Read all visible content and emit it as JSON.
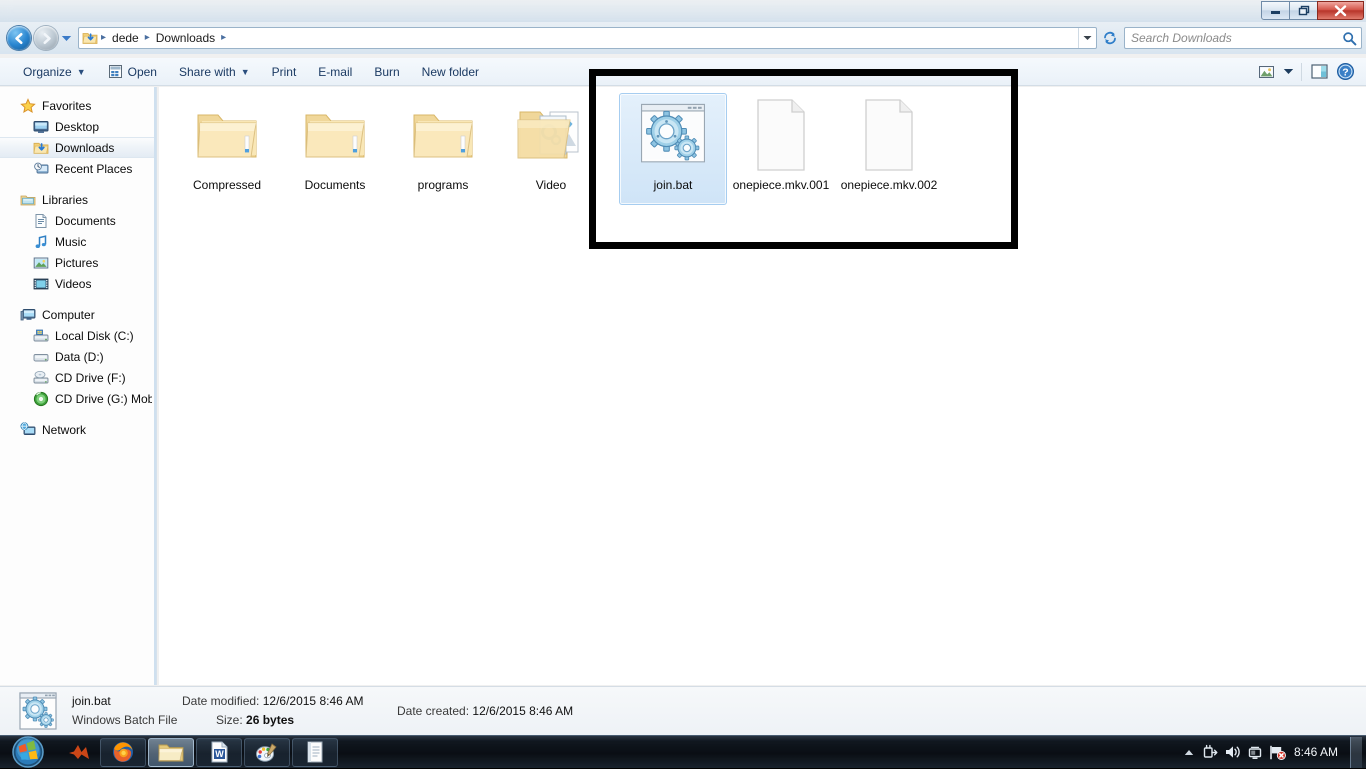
{
  "window": {
    "controls": {
      "minimize_label": "Minimize",
      "restore_label": "Restore Down",
      "close_label": "Close"
    }
  },
  "navigation": {
    "back_label": "Back",
    "forward_label": "Forward",
    "history_label": "Recent pages",
    "refresh_label": "Refresh",
    "address_icon": "downloads-folder-icon",
    "breadcrumbs": [
      "dede",
      "Downloads"
    ],
    "separator": "▸"
  },
  "search": {
    "placeholder": "Search Downloads",
    "value": "",
    "icon": "search-icon"
  },
  "command_bar": {
    "items": [
      {
        "label": "Organize",
        "icon": "",
        "caret": true
      },
      {
        "label": "Open",
        "icon": "open-file-icon",
        "caret": false
      },
      {
        "label": "Share with",
        "icon": "",
        "caret": true
      },
      {
        "label": "Print",
        "icon": "",
        "caret": false
      },
      {
        "label": "E-mail",
        "icon": "",
        "caret": false
      },
      {
        "label": "Burn",
        "icon": "",
        "caret": false
      },
      {
        "label": "New folder",
        "icon": "",
        "caret": false
      }
    ],
    "right_buttons": [
      {
        "name": "change-view-button",
        "icon": "view-icon"
      },
      {
        "name": "change-view-dropdown",
        "icon": "chevron-down-icon"
      },
      {
        "name": "preview-pane-button",
        "icon": "preview-pane-icon"
      },
      {
        "name": "help-button",
        "icon": "help-icon"
      }
    ]
  },
  "sidebar": {
    "groups": [
      {
        "root": {
          "label": "Favorites",
          "icon": "star-icon"
        },
        "items": [
          {
            "label": "Desktop",
            "icon": "desktop-icon",
            "selected": false
          },
          {
            "label": "Downloads",
            "icon": "downloads-folder-icon",
            "selected": true
          },
          {
            "label": "Recent Places",
            "icon": "recent-places-icon",
            "selected": false
          }
        ]
      },
      {
        "root": {
          "label": "Libraries",
          "icon": "libraries-icon"
        },
        "items": [
          {
            "label": "Documents",
            "icon": "documents-library-icon",
            "selected": false
          },
          {
            "label": "Music",
            "icon": "music-library-icon",
            "selected": false
          },
          {
            "label": "Pictures",
            "icon": "pictures-library-icon",
            "selected": false
          },
          {
            "label": "Videos",
            "icon": "videos-library-icon",
            "selected": false
          }
        ]
      },
      {
        "root": {
          "label": "Computer",
          "icon": "computer-icon"
        },
        "items": [
          {
            "label": "Local Disk (C:)",
            "icon": "system-drive-icon",
            "selected": false
          },
          {
            "label": "Data (D:)",
            "icon": "drive-icon",
            "selected": false
          },
          {
            "label": "CD Drive (F:)",
            "icon": "cd-drive-icon",
            "selected": false
          },
          {
            "label": "CD Drive (G:) Mobile",
            "icon": "cd-drive-green-icon",
            "selected": false
          }
        ]
      },
      {
        "root": {
          "label": "Network",
          "icon": "network-icon"
        },
        "items": []
      }
    ]
  },
  "content": {
    "items": [
      {
        "label": "Compressed",
        "icon": "folder-icon",
        "selected": false
      },
      {
        "label": "Documents",
        "icon": "folder-icon",
        "selected": false
      },
      {
        "label": "programs",
        "icon": "folder-icon",
        "selected": false
      },
      {
        "label": "Video",
        "icon": "folder-with-previews-icon",
        "selected": false
      },
      {
        "label": "join.bat",
        "icon": "batch-file-icon",
        "selected": true
      },
      {
        "label": "onepiece.mkv.001",
        "icon": "blank-document-icon",
        "selected": false
      },
      {
        "label": "onepiece.mkv.002",
        "icon": "blank-document-icon",
        "selected": false
      }
    ]
  },
  "details_pane": {
    "icon": "batch-file-icon",
    "file_name": "join.bat",
    "file_type": "Windows Batch File",
    "date_modified_key": "Date modified:",
    "date_modified_value": "12/6/2015 8:46 AM",
    "date_created_key": "Date created:",
    "date_created_value": "12/6/2015 8:46 AM",
    "size_key": "Size:",
    "size_value": "26 bytes"
  },
  "taskbar": {
    "start_label": "Start",
    "buttons": [
      {
        "name": "taskbar-matlab",
        "icon": "matlab-icon",
        "active": false,
        "plain": true
      },
      {
        "name": "taskbar-firefox",
        "icon": "firefox-icon",
        "active": false,
        "plain": false
      },
      {
        "name": "taskbar-explorer",
        "icon": "explorer-icon",
        "active": true,
        "plain": false
      },
      {
        "name": "taskbar-word",
        "icon": "word-icon",
        "active": false,
        "plain": false
      },
      {
        "name": "taskbar-paint",
        "icon": "paint-icon",
        "active": false,
        "plain": false
      },
      {
        "name": "taskbar-notepad",
        "icon": "notepad-icon",
        "active": false,
        "plain": false
      }
    ],
    "tray": [
      {
        "name": "tray-show-hidden-icons",
        "icon": "chevron-up-icon"
      },
      {
        "name": "tray-power",
        "icon": "power-plug-icon"
      },
      {
        "name": "tray-volume",
        "icon": "speaker-icon"
      },
      {
        "name": "tray-network",
        "icon": "network-monitor-icon"
      },
      {
        "name": "tray-action-center",
        "icon": "flag-error-icon"
      }
    ],
    "clock": "8:46 AM",
    "show_desktop_label": "Show desktop"
  },
  "colors": {
    "selection": "#cfe4f7",
    "selection_border": "#a6cdf0",
    "accent": "#2a86d0",
    "annotation": "#000000",
    "folder": "#f7d882"
  }
}
